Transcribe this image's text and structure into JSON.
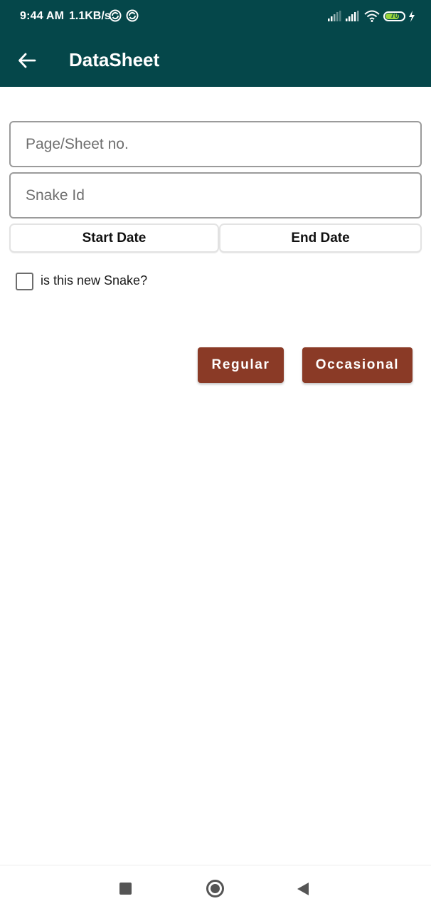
{
  "status_bar": {
    "time": "9:44 AM",
    "net_speed": "1.1KB/s",
    "battery_level": "70",
    "icons": [
      "sync-icon",
      "sync-icon",
      "signal-icon",
      "signal-icon",
      "wifi-icon",
      "battery-icon",
      "charging-icon"
    ]
  },
  "app_bar": {
    "title": "DataSheet",
    "back_icon": "arrow-back-icon",
    "background": "#05474a"
  },
  "form": {
    "page_sheet_no": {
      "value": "",
      "placeholder": "Page/Sheet no."
    },
    "snake_id": {
      "value": "",
      "placeholder": "Snake Id"
    },
    "start_date_label": "Start Date",
    "end_date_label": "End Date",
    "new_snake": {
      "label": "is this new Snake?",
      "checked": false
    }
  },
  "actions": {
    "regular_label": "Regular",
    "occasional_label": "Occasional",
    "color": "#8a3a26"
  },
  "nav_bar": {
    "icons": [
      "recents-icon",
      "home-icon",
      "back-icon"
    ]
  }
}
